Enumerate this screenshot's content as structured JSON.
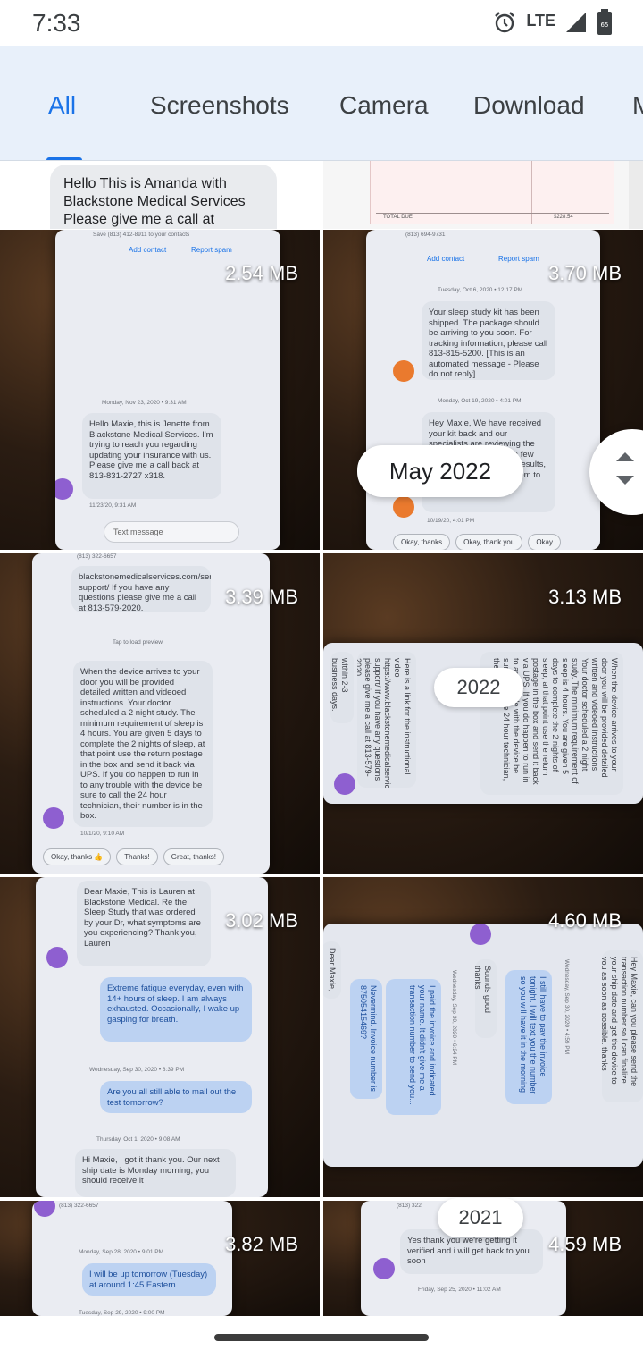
{
  "status_bar": {
    "time": "7:33",
    "network": "LTE",
    "battery_level": "65",
    "icons": [
      "alarm-icon",
      "signal-icon",
      "battery-icon"
    ]
  },
  "tabs": {
    "items": [
      {
        "label": "All",
        "active": true
      },
      {
        "label": "Screenshots",
        "active": false
      },
      {
        "label": "Camera",
        "active": false
      },
      {
        "label": "Download",
        "active": false
      },
      {
        "label": "M",
        "active": false
      }
    ],
    "accent_color": "#1a73e8"
  },
  "partial_row": {
    "left_message": "Hello This is Amanda with Blackstone Medical Services Please give me a call at",
    "right_receipt": {
      "total_label": "TOTAL DUE",
      "amount": "$228.54"
    }
  },
  "tiles": [
    {
      "size": "2.54 MB",
      "header_line": "Save (813) 412-8911 to your contacts",
      "actions": [
        "Add contact",
        "Report spam"
      ],
      "timestamp": "Monday, Nov 23, 2020 • 9:31 AM",
      "message": "Hello Maxie, this is Jenette from Blackstone Medical Services. I'm trying to reach you regarding updating your insurance with us. Please give me a call back at 813-831-2727 x318.",
      "message_time": "11/23/20, 9:31 AM",
      "input_placeholder": "Text message"
    },
    {
      "size": "3.70 MB",
      "header_line": "(813) 694-9731",
      "actions": [
        "Add contact",
        "Report spam"
      ],
      "timestamp": "Tuesday, Oct 6, 2020 • 12:17 PM",
      "message": "Your sleep study kit has been shipped. The package should be arriving to you soon. For tracking information, please call 813-815-5200. [This is an automated message - Please do not reply]",
      "timestamp2": "Monday, Oct 19, 2020 • 4:01 PM",
      "message2": "Hey Maxie, We have received your kit back and our specialists are reviewing the results. This may take a few days. Once you get the results, you will follow up with them to find out what is next.",
      "message2_time": "10/19/20, 4:01 PM",
      "chips": [
        "Okay, thanks",
        "Okay, thank you",
        "Okay"
      ]
    },
    {
      "size": "3.39 MB",
      "header_line": "(813) 322-6657",
      "message_top": "blackstonemedicalservices.com/service-support/ If you have any questions please give me a call at 813-579-2020.",
      "preview_note": "Tap to load preview",
      "message": "When the device arrives to your door you will be provided detailed written and videoed instructions. Your doctor scheduled a 2 night study. The minimum requirement of sleep is 4 hours. You are given 5 days to complete the 2 nights of sleep, at that point use the return postage in the box and send it back via UPS. If you do happen to run in to any trouble with the device be sure to call the 24 hour technician, their number is in the box.",
      "message_time": "10/1/20, 9:10 AM",
      "chips": [
        "Okay, thanks 👍",
        "Thanks!",
        "Great, thanks!"
      ]
    },
    {
      "size": "3.13 MB",
      "rotated_messages": [
        "within 2-3 business days. Take care!",
        "Here is a link for the instructional video https://www.blackstonemedicalservices.com/service-support/ If you have any questions please give me a call at 813-579-2020.",
        "When the device arrives to your door you will be provided detailed written and videoed instructions. Your doctor scheduled a 2 night study. The minimum requirement of sleep is 4 hours. You are given 5 days to complete the 2 nights of sleep, at that point use the return postage in the box and send it back via UPS. If you do happen to run in to any trouble with the device be sure to call the 24 hour technician, their"
      ]
    },
    {
      "size": "3.02 MB",
      "message": "Dear Maxie, This is Lauren at Blackstone Medical. Re the Sleep Study that was ordered by your Dr, what symptoms are you experiencing? Thank you, Lauren",
      "reply": "Extreme fatigue everyday, even with 14+ hours of sleep. I am always exhausted. Occasionally, I wake up gasping for breath.",
      "timestamp": "Wednesday, Sep 30, 2020 • 8:39 PM",
      "reply2": "Are you all still able to mail out the test tomorrow?",
      "timestamp2": "Thursday, Oct 1, 2020 • 9:08 AM",
      "message2": "Hi Maxie, I got it thank you. Our next ship date is Monday morning, you should receive it"
    },
    {
      "size": "4.60 MB",
      "rotated_messages": [
        "Hey Maxie, can you please send the transaction number so I can finalize your ship date and get the device to you as soon as possible. thanks",
        "I still have to pay the invoice tonight. I will text you the number so you will have it in the morning",
        "Sounds good thanks",
        "I paid the invoice and indicated your name. It didn't give me a transaction number to send you...",
        "Nevermind. Invoice number is 87505415469?",
        "Dear Maxie,"
      ],
      "timestamps": [
        "Wednesday, Sep 30, 2020 • 4:59 PM",
        "Wednesday, Sep 30, 2020 • 6:24 PM"
      ]
    },
    {
      "size": "3.82 MB",
      "header_line": "(813) 322-6657",
      "timestamp": "Monday, Sep 28, 2020 • 9:01 PM",
      "reply": "I will be up tomorrow (Tuesday) at around 1:45 Eastern.",
      "timestamp2": "Tuesday, Sep 29, 2020 • 9:00 PM"
    },
    {
      "size": "4.59 MB",
      "header_line": "(813) 322",
      "message": "Yes thank you we're getting it verified and i will get back to you soon",
      "timestamp": "Friday, Sep 25, 2020 • 11:02 AM"
    }
  ],
  "date_scrubber": {
    "current_label": "May 2022",
    "year_labels": [
      "2022",
      "2021"
    ]
  }
}
